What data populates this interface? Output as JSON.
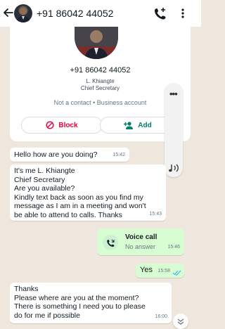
{
  "header": {
    "title": "+91 86042 44052"
  },
  "profile": {
    "phone": "+91 86042 44052",
    "name": "L. Khiangte",
    "role": "Chief Secretary",
    "status": "Not a contact • Business account",
    "block_label": "Block",
    "add_label": "Add"
  },
  "messages": {
    "m1": {
      "text": "Hello how are you doing?",
      "time": "15:42"
    },
    "m2": {
      "lines": [
        "It's me L. Khiangte",
        "Chief Secretary",
        "Are you available?",
        "Kindly text back as soon as you find my",
        "message as I am in a meeting and won't",
        "be able to attend to calls. Thanks"
      ],
      "time": "15:43"
    },
    "voice_call": {
      "title": "Voice call",
      "subtitle": "No answer",
      "time": "15:46"
    },
    "yes": {
      "text": "Yes",
      "time": "15:58"
    },
    "m3": {
      "lines": [
        "Thanks",
        "Please where are you at the moment?",
        "There is something I need you to please",
        "do for me if possible"
      ],
      "time": "16:00"
    }
  },
  "colors": {
    "chat_bg": "#efe7de",
    "outgoing_bubble": "#d9fdd3",
    "accent_green": "#008069",
    "block_red": "#ea0038",
    "read_tick_blue": "#53bdeb"
  },
  "icons": [
    "back-arrow-icon",
    "call-add-icon",
    "menu-icon",
    "block-icon",
    "add-contact-icon",
    "voice-call-icon",
    "double-tick-icon",
    "chevron-down-icon",
    "audio-icon"
  ]
}
